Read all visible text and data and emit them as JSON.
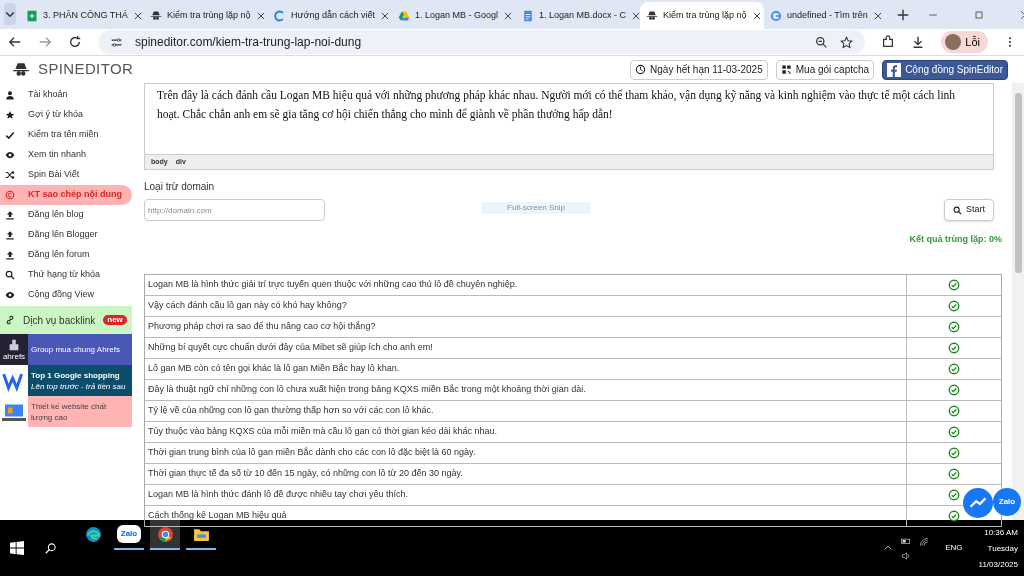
{
  "browser": {
    "tabs": [
      {
        "title": "3. PHÂN CÔNG THÁ",
        "kind": "sheets",
        "selected": false
      },
      {
        "title": "Kiểm tra trùng lặp nộ",
        "kind": "spy",
        "selected": false
      },
      {
        "title": "Hướng dẫn cách viết",
        "kind": "c-logo",
        "selected": false
      },
      {
        "title": "1. Logan MB - Googl",
        "kind": "drive",
        "selected": false
      },
      {
        "title": "1. Logan MB.docx - C",
        "kind": "docs",
        "selected": false
      },
      {
        "title": "Kiểm tra trùng lặp nộ",
        "kind": "spy",
        "selected": true
      },
      {
        "title": "undefined - Tìm trên",
        "kind": "google",
        "selected": false
      }
    ],
    "url": "spineditor.com/kiem-tra-trung-lap-noi-dung",
    "profile": "Lỗi"
  },
  "site": {
    "logo": "SPINEDITOR",
    "header_buttons": [
      {
        "label": "Ngày hết hạn 11-03-2025",
        "kind": "clock"
      },
      {
        "label": "Mua gói captcha",
        "kind": "qr"
      },
      {
        "label": "Cộng đồng SpinEditor",
        "kind": "facebook"
      }
    ]
  },
  "sidebar": {
    "items": [
      {
        "label": "Tài khoản",
        "kind": "user",
        "selected": false
      },
      {
        "label": "Gợi ý từ khóa",
        "kind": "star",
        "selected": false
      },
      {
        "label": "Kiểm tra tên miền",
        "kind": "check",
        "selected": false
      },
      {
        "label": "Xem tin nhanh",
        "kind": "eye",
        "selected": false
      },
      {
        "label": "Spin Bài Viết",
        "kind": "shuffle",
        "selected": false
      },
      {
        "label": "KT sao chép nội dung",
        "kind": "copyright",
        "selected": true
      },
      {
        "label": "Đăng lên blog",
        "kind": "upload",
        "selected": false
      },
      {
        "label": "Đăng lên Blogger",
        "kind": "upload",
        "selected": false
      },
      {
        "label": "Đăng lên forum",
        "kind": "upload",
        "selected": false
      },
      {
        "label": "Thứ hạng từ khóa",
        "kind": "search",
        "selected": false
      },
      {
        "label": "Cộng đồng View",
        "kind": "eye",
        "selected": false
      }
    ],
    "backlink": {
      "label": "Dịch vụ backlink",
      "badge": "new"
    },
    "promos": [
      {
        "kind": "ahrefs",
        "logo": "ahrefs",
        "title": "Group mua chung Ahrefs"
      },
      {
        "kind": "shopping",
        "title": "Top 1 Google shopping",
        "subtitle": "Lên top trước - trả tiền sau"
      },
      {
        "kind": "website",
        "title": "Thiết kế website chất lượng cao"
      }
    ]
  },
  "editor": {
    "text": "Trên đây là cách đánh cầu Logan MB hiệu quả với những phương pháp khác nhau. Người mới có thể tham khảo, vận dụng kỹ năng và kinh nghiệm vào thực tế một cách linh hoạt. Chắc chắn anh em sẽ gia tăng cơ hội chiến thắng cho mình để giành về phần thưởng hấp dẫn!",
    "path": [
      "body",
      "div"
    ]
  },
  "exclude": {
    "label": "Loại trừ domain",
    "placeholder": "http://domain.com",
    "button": "Start"
  },
  "snip": "Full-screen Snip",
  "result": "Kết quả trùng lặp: 0%",
  "rows": [
    {
      "text": "Logan MB là hình thức giải trí trực tuyến quen thuộc với những cao thủ lô đề chuyên nghiệp.",
      "unique": true
    },
    {
      "text": "Vậy cách đánh cầu lô gan này có khó hay không?",
      "unique": true
    },
    {
      "text": "Phương pháp chơi ra sao để thu nâng cao cơ hội thắng?",
      "unique": true
    },
    {
      "text": "Những bí quyết cực chuẩn dưới đây của Mibet sẽ giúp ích cho anh em!",
      "unique": true
    },
    {
      "text": "Lô gan MB còn có tên gọi khác là lô gan Miền Bắc hay lô khan.",
      "unique": true
    },
    {
      "text": "Đây là thuật ngữ chỉ những con lô chưa xuất hiện trong bảng KQXS miền Bắc trong một khoảng thời gian dài.",
      "unique": true
    },
    {
      "text": "Tỷ lệ về của những con lô gan thường thấp hơn so với các con lô khác.",
      "unique": true
    },
    {
      "text": "Tùy thuộc vào bảng KQXS của mỗi miền mà cầu lô gan có thời gian kéo dài khác nhau.",
      "unique": true
    },
    {
      "text": "Thời gian trung bình của lô gan miền Bắc dành cho các con lô đặc biệt là 60 ngày.",
      "unique": true
    },
    {
      "text": "Thời gian thực tế đa số từ 10 đến 15 ngày, có những con lô từ 20 đến 30 ngày.",
      "unique": true
    },
    {
      "text": "Logan MB là hình thức đánh lô đề được nhiều tay chơi yêu thích.",
      "unique": true
    },
    {
      "text": "Cách thống kê Logan MB hiệu quả",
      "unique": true
    }
  ],
  "chat": {
    "zalo": "Zalo"
  },
  "taskbar": {
    "apps": [
      {
        "kind": "edge",
        "active": false
      },
      {
        "kind": "zalo",
        "label": "Zalo",
        "active": true
      },
      {
        "kind": "chrome",
        "active": true
      },
      {
        "kind": "folder",
        "active": true
      }
    ],
    "language": "ENG",
    "time": "10:36 AM",
    "day": "Tuesday",
    "date": "11/03/2025"
  }
}
